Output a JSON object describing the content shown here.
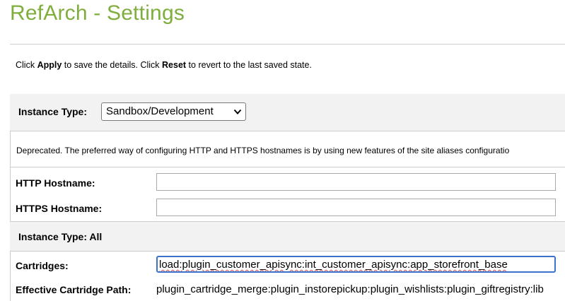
{
  "page": {
    "title": "RefArch - Settings",
    "intro": {
      "part1": "Click ",
      "apply": "Apply",
      "part2": " to save the details. Click ",
      "reset": "Reset",
      "part3": " to revert to the last saved state."
    }
  },
  "instance_type": {
    "label": "Instance Type:",
    "selected": "Sandbox/Development"
  },
  "deprecated_note": "Deprecated. The preferred way of configuring HTTP and HTTPS hostnames is by using new features of the site aliases configuratio",
  "http_hostname": {
    "label": "HTTP Hostname:",
    "value": ""
  },
  "https_hostname": {
    "label": "HTTPS Hostname:",
    "value": ""
  },
  "instance_all": {
    "label": "Instance Type:  All"
  },
  "cartridges": {
    "label": "Cartridges:",
    "value": "load:plugin_customer_apisync:int_customer_apisync:app_storefront_base"
  },
  "effective_path": {
    "label": "Effective Cartridge Path:",
    "value": "plugin_cartridge_merge:plugin_instorepickup:plugin_wishlists:plugin_giftregistry:lib"
  },
  "colors": {
    "title": "#7fae3e",
    "focus_border": "#3b73c9",
    "row_background": "#f2f2f2"
  }
}
